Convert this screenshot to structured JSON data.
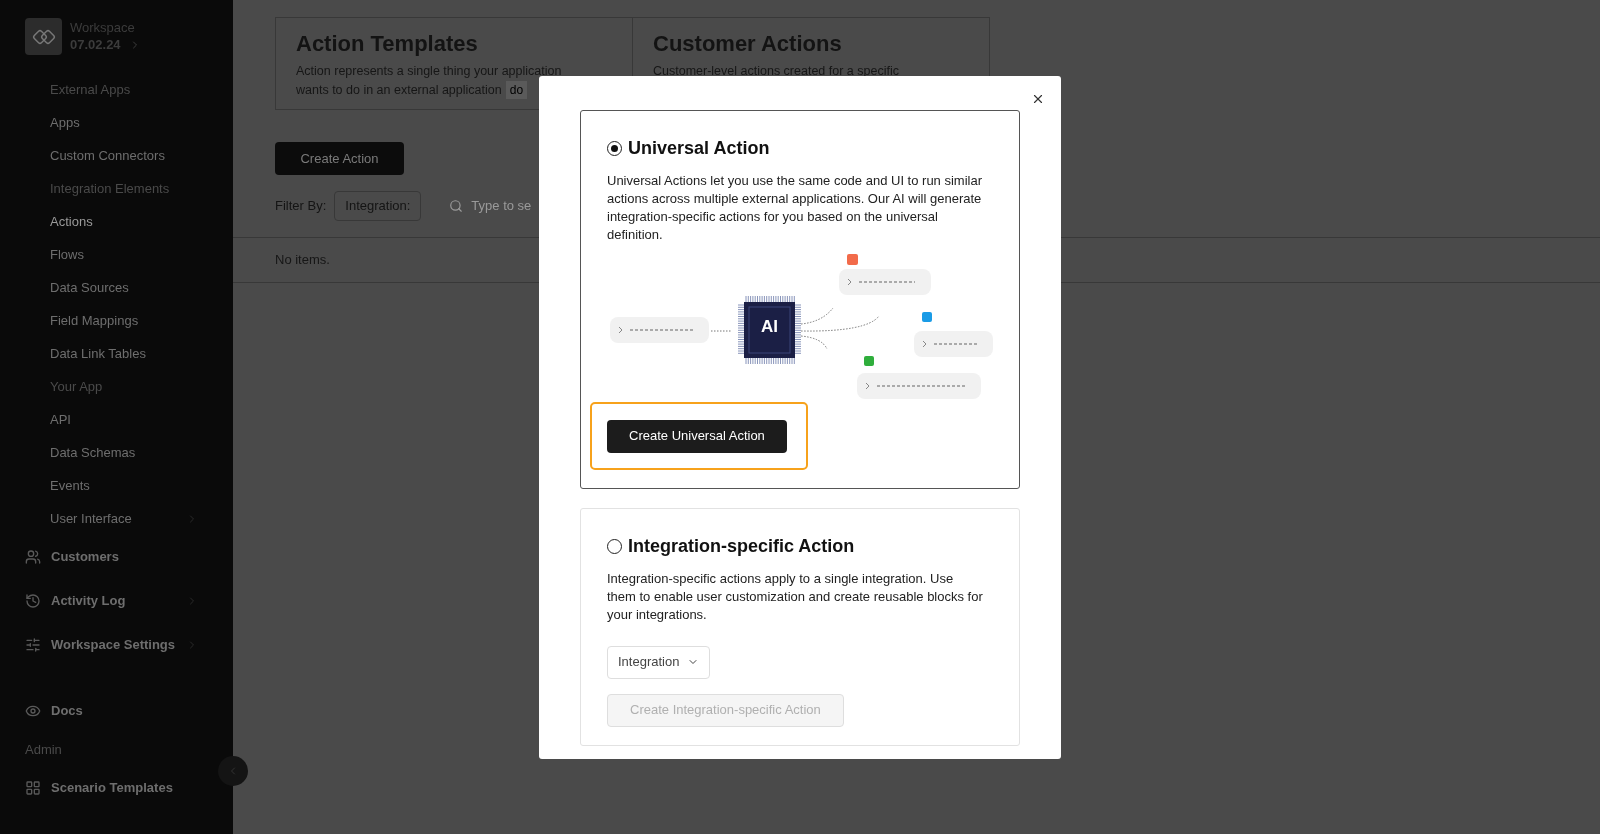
{
  "sidebar": {
    "workspace": {
      "label": "Workspace",
      "version": "07.02.24"
    },
    "items": [
      {
        "kind": "heading",
        "label": "External Apps"
      },
      {
        "kind": "link",
        "label": "Apps",
        "selected": false,
        "has_submenu": false
      },
      {
        "kind": "link",
        "label": "Custom Connectors",
        "selected": false,
        "has_submenu": false
      },
      {
        "kind": "heading",
        "label": "Integration Elements"
      },
      {
        "kind": "link",
        "label": "Actions",
        "selected": true,
        "has_submenu": false
      },
      {
        "kind": "link",
        "label": "Flows",
        "selected": false,
        "has_submenu": false
      },
      {
        "kind": "link",
        "label": "Data Sources",
        "selected": false,
        "has_submenu": false
      },
      {
        "kind": "link",
        "label": "Field Mappings",
        "selected": false,
        "has_submenu": false
      },
      {
        "kind": "link",
        "label": "Data Link Tables",
        "selected": false,
        "has_submenu": false
      },
      {
        "kind": "heading",
        "label": "Your App"
      },
      {
        "kind": "link",
        "label": "API",
        "selected": false,
        "has_submenu": false
      },
      {
        "kind": "link",
        "label": "Data Schemas",
        "selected": false,
        "has_submenu": false
      },
      {
        "kind": "link",
        "label": "Events",
        "selected": false,
        "has_submenu": false
      },
      {
        "kind": "link",
        "label": "User Interface",
        "selected": false,
        "has_submenu": true
      },
      {
        "kind": "section",
        "label": "Customers",
        "has_submenu": false
      },
      {
        "kind": "section",
        "label": "Activity Log",
        "has_submenu": true
      },
      {
        "kind": "section",
        "label": "Workspace Settings",
        "has_submenu": true
      },
      {
        "kind": "spacer"
      },
      {
        "kind": "section",
        "label": "Docs",
        "has_submenu": false
      },
      {
        "kind": "heading",
        "label": "Admin"
      },
      {
        "kind": "section",
        "label": "Scenario Templates",
        "has_submenu": false
      }
    ]
  },
  "header_cards": [
    {
      "title": "Action Templates",
      "description": "Action represents a single thing your application",
      "description_2": "wants to do in an external application",
      "tag": "do"
    },
    {
      "title": "Customer Actions",
      "description": "Customer-level actions created for a specific"
    }
  ],
  "create_button": "Create Action",
  "filter": {
    "label": "Filter By:",
    "integration": "Integration:",
    "search_placeholder": "Type to se"
  },
  "empty_text": "No items.",
  "modal": {
    "options": [
      {
        "kind": "universal",
        "title": "Universal Action",
        "selected": true,
        "description": "Universal Actions let you use the same code and UI to run similar actions across multiple external applications. Our AI will generate integration-specific actions for you based on the universal definition.",
        "chip_label": "AI",
        "button": {
          "label": "Create Universal Action",
          "disabled": false,
          "highlighted": true
        }
      },
      {
        "kind": "integration",
        "title": "Integration-specific Action",
        "selected": false,
        "description": "Integration-specific actions apply to a single integration. Use them to enable user customization and create reusable blocks for your integrations.",
        "select": "Integration",
        "button": {
          "label": "Create Integration-specific Action",
          "disabled": true,
          "highlighted": false
        }
      }
    ]
  }
}
